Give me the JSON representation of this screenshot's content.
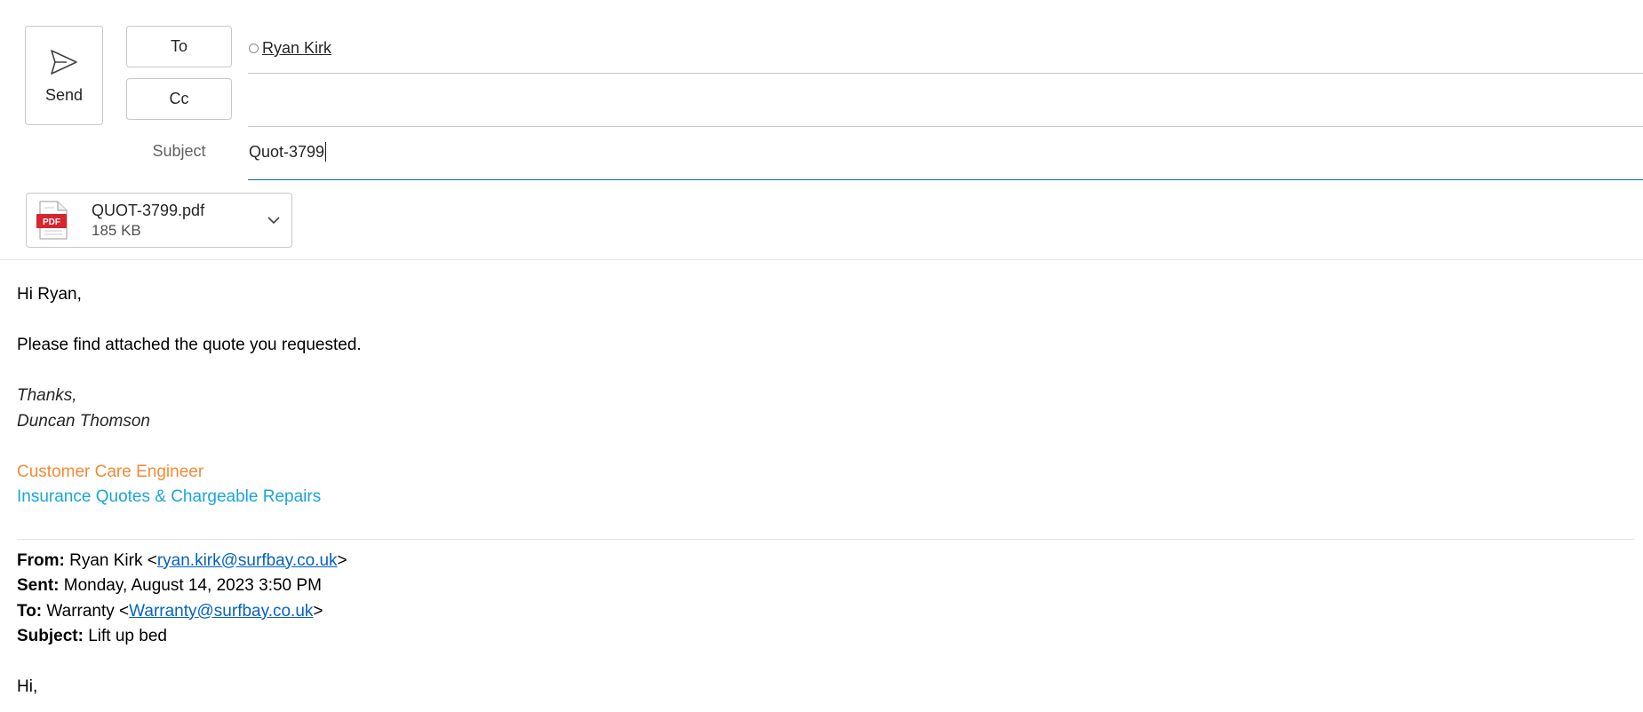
{
  "compose": {
    "send_label": "Send",
    "to_label": "To",
    "cc_label": "Cc",
    "subject_label": "Subject",
    "to_recipient": "Ryan Kirk",
    "cc_value": "",
    "subject_value": "Quot-3799"
  },
  "attachment": {
    "file_name": "QUOT-3799.pdf",
    "file_size": "185 KB",
    "icon_label": "PDF"
  },
  "body": {
    "greeting": "Hi Ryan,",
    "message": "Please find attached the quote you requested.",
    "signoff": "Thanks,",
    "sender_name": "Duncan Thomson",
    "job_title": "Customer Care Engineer",
    "department": "Insurance Quotes & Chargeable Repairs"
  },
  "quoted": {
    "from_label": "From:",
    "from_name": " Ryan Kirk <",
    "from_email": "ryan.kirk@surfbay.co.uk",
    "from_close": ">",
    "sent_label": "Sent:",
    "sent_value": " Monday, August 14, 2023 3:50 PM",
    "to_label": "To:",
    "to_name": " Warranty <",
    "to_email": "Warranty@surfbay.co.uk",
    "to_close": ">",
    "subject_label": "Subject:",
    "subject_value": " Lift up bed",
    "greeting": "Hi,"
  },
  "colors": {
    "accent": "#0f6cbd",
    "job_title": "#f38a36",
    "department": "#1aa5dc",
    "link": "#0563c1",
    "pdf_red": "#d9232e"
  }
}
